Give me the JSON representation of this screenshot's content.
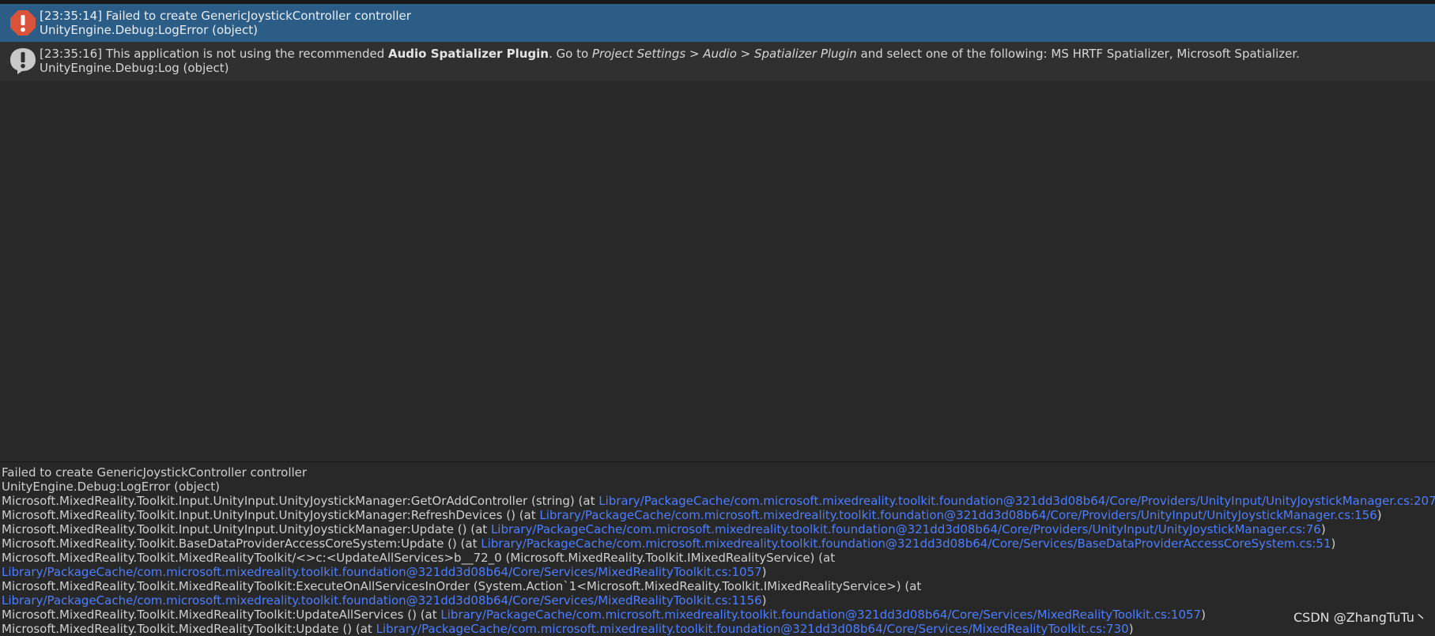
{
  "colors": {
    "background": "#282828",
    "selected_row": "#2c5d87",
    "link": "#4c7eff",
    "error_icon": "#d9533b",
    "info_icon": "#c8c8c8"
  },
  "log_entries": [
    {
      "icon": "error-icon",
      "line1": "[23:35:14] Failed to create GenericJoystickController controller",
      "line2": "UnityEngine.Debug:LogError (object)"
    },
    {
      "icon": "info-icon",
      "line1_parts": [
        "[23:35:16] This application is not using the recommended ",
        "Audio Spatializer Plugin",
        ". Go to ",
        "Project Settings > Audio > Spatializer Plugin",
        " and select one of the following: MS HRTF Spatializer, Microsoft Spatializer."
      ],
      "line2": "UnityEngine.Debug:Log (object)"
    }
  ],
  "detail": {
    "lines": [
      {
        "text": "Failed to create GenericJoystickController controller"
      },
      {
        "text": "UnityEngine.Debug:LogError (object)"
      },
      {
        "text": "Microsoft.MixedReality.Toolkit.Input.UnityInput.UnityJoystickManager:GetOrAddController (string) (at ",
        "link": "Library/PackageCache/com.microsoft.mixedreality.toolkit.foundation@321dd3d08b64/Core/Providers/UnityInput/UnityJoystickManager.cs:207",
        "suffix": ")"
      },
      {
        "text": "Microsoft.MixedReality.Toolkit.Input.UnityInput.UnityJoystickManager:RefreshDevices () (at ",
        "link": "Library/PackageCache/com.microsoft.mixedreality.toolkit.foundation@321dd3d08b64/Core/Providers/UnityInput/UnityJoystickManager.cs:156",
        "suffix": ")"
      },
      {
        "text": "Microsoft.MixedReality.Toolkit.Input.UnityInput.UnityJoystickManager:Update () (at ",
        "link": "Library/PackageCache/com.microsoft.mixedreality.toolkit.foundation@321dd3d08b64/Core/Providers/UnityInput/UnityJoystickManager.cs:76",
        "suffix": ")"
      },
      {
        "text": "Microsoft.MixedReality.Toolkit.BaseDataProviderAccessCoreSystem:Update () (at ",
        "link": "Library/PackageCache/com.microsoft.mixedreality.toolkit.foundation@321dd3d08b64/Core/Services/BaseDataProviderAccessCoreSystem.cs:51",
        "suffix": ")"
      },
      {
        "text": "Microsoft.MixedReality.Toolkit.MixedRealityToolkit/<>c:<UpdateAllServices>b__72_0 (Microsoft.MixedReality.Toolkit.IMixedRealityService) (at"
      },
      {
        "text": "",
        "link": "Library/PackageCache/com.microsoft.mixedreality.toolkit.foundation@321dd3d08b64/Core/Services/MixedRealityToolkit.cs:1057",
        "suffix": ")"
      },
      {
        "text": "Microsoft.MixedReality.Toolkit.MixedRealityToolkit:ExecuteOnAllServicesInOrder (System.Action`1<Microsoft.MixedReality.Toolkit.IMixedRealityService>) (at"
      },
      {
        "text": "",
        "link": "Library/PackageCache/com.microsoft.mixedreality.toolkit.foundation@321dd3d08b64/Core/Services/MixedRealityToolkit.cs:1156",
        "suffix": ")"
      },
      {
        "text": "Microsoft.MixedReality.Toolkit.MixedRealityToolkit:UpdateAllServices () (at ",
        "link": "Library/PackageCache/com.microsoft.mixedreality.toolkit.foundation@321dd3d08b64/Core/Services/MixedRealityToolkit.cs:1057",
        "suffix": ")"
      },
      {
        "text": "Microsoft.MixedReality.Toolkit.MixedRealityToolkit:Update () (at ",
        "link": "Library/PackageCache/com.microsoft.mixedreality.toolkit.foundation@321dd3d08b64/Core/Services/MixedRealityToolkit.cs:730",
        "suffix": ")"
      }
    ]
  },
  "watermark": "CSDN @ZhangTuTu丶"
}
